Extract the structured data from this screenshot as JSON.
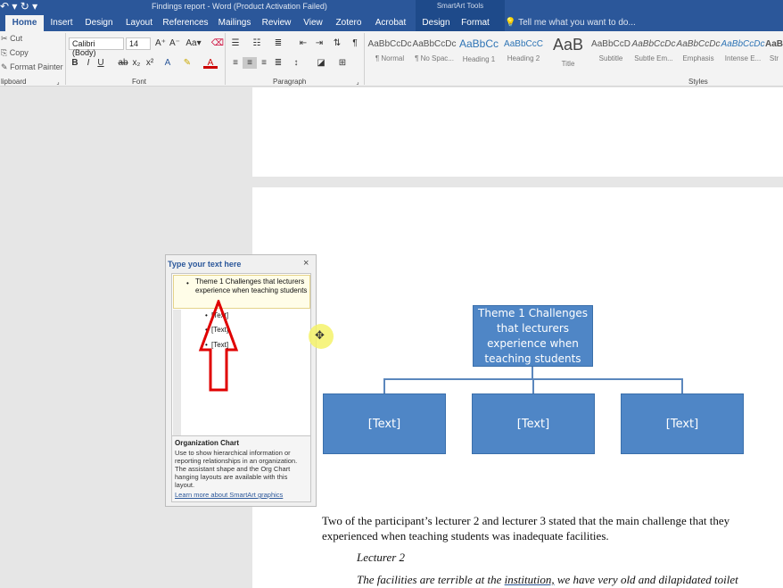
{
  "titlebar": {
    "quick_access": "↶ ▾ ↻ ▾",
    "title": "Findings report - Word (Product Activation Failed)",
    "context_group": "SmartArt Tools"
  },
  "tabs": [
    "Home",
    "Insert",
    "Design",
    "Layout",
    "References",
    "Mailings",
    "Review",
    "View",
    "Zotero",
    "Acrobat",
    "Design",
    "Format"
  ],
  "tell_me": "Tell me what you want to do...",
  "clipboard": {
    "cut": "Cut",
    "copy": "Copy",
    "format_painter": "Format Painter",
    "group": "lipboard"
  },
  "font": {
    "family": "Calibri (Body)",
    "size": "14",
    "group": "Font"
  },
  "paragraph": {
    "group": "Paragraph"
  },
  "styles": {
    "group": "Styles",
    "items": [
      {
        "preview": "AaBbCcDc",
        "name": "¶ Normal"
      },
      {
        "preview": "AaBbCcDc",
        "name": "¶ No Spac..."
      },
      {
        "preview": "AaBbCc",
        "name": "Heading 1"
      },
      {
        "preview": "AaBbCcC",
        "name": "Heading 2"
      },
      {
        "preview": "AaB",
        "name": "Title"
      },
      {
        "preview": "AaBbCcD",
        "name": "Subtitle"
      },
      {
        "preview": "AaBbCcDc",
        "name": "Subtle Em..."
      },
      {
        "preview": "AaBbCcDc",
        "name": "Emphasis"
      },
      {
        "preview": "AaBbCcDc",
        "name": "Intense E..."
      },
      {
        "preview": "AaBbCcDc",
        "name": "Str"
      }
    ]
  },
  "text_pane": {
    "header": "Type your text here",
    "close": "×",
    "bullet_1": "Theme 1 Challenges that lecturers experience when teaching students",
    "sub_1": "[Text]",
    "sub_2": "[Text]",
    "sub_3": "[Text]",
    "desc_title": "Organization Chart",
    "desc_body": "Use to show hierarchical information or reporting relationships in an organization. The assistant shape and the Org Chart hanging layouts are available with this layout.",
    "desc_link": "Learn more about SmartArt graphics"
  },
  "smartart": {
    "top": "Theme 1 Challenges that lecturers experience when teaching students",
    "children": [
      "[Text]",
      "[Text]",
      "[Text]"
    ]
  },
  "document": {
    "para1_line1": "Two of the participant’s lecturer 2 and lecturer 3 stated that the main challenge that they",
    "para1_line2": "experienced when teaching students was inadequate facilities.",
    "quote_heading": "Lecturer 2",
    "quote_line_start": "The facilities are terrible at the ",
    "quote_line_underlined": "institution,",
    "quote_line_end": " we have very old and dilapidated toilet"
  },
  "colors": {
    "ribbon_blue": "#2b579a",
    "smartart_fill": "#4f86c6",
    "annotation_red": "#e00000",
    "cursor_highlight": "#f5f36a"
  }
}
